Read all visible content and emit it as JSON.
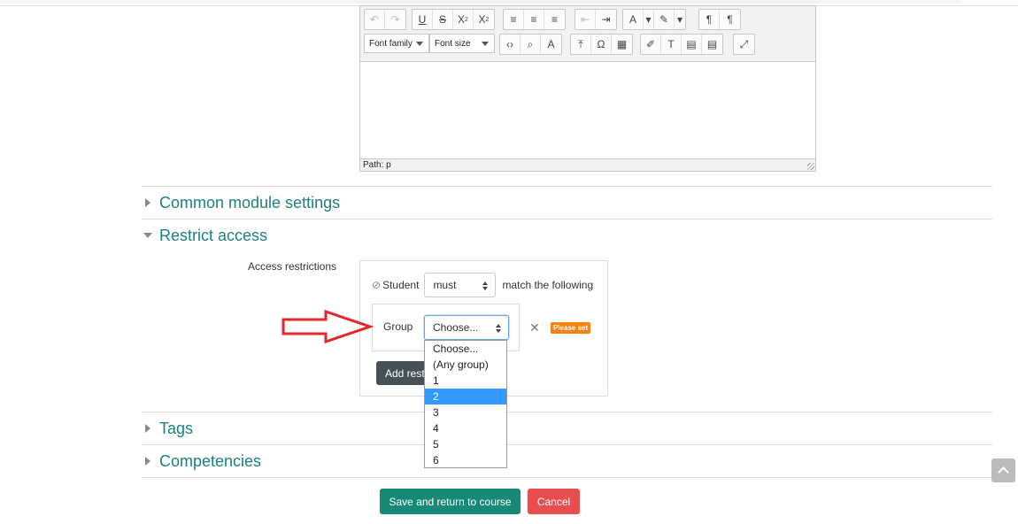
{
  "editor": {
    "font_family_label": "Font family",
    "font_size_label": "Font size",
    "path_label": "Path: p"
  },
  "sections": {
    "common_module": "Common module settings",
    "restrict_access": "Restrict access",
    "tags": "Tags",
    "competencies": "Competencies"
  },
  "restrict": {
    "access_label": "Access restrictions",
    "student_label": "Student",
    "must_value": "must",
    "match_text": "match the following",
    "group_label": "Group",
    "group_select_value": "Choose...",
    "please_set_badge": "Please set",
    "add_restriction_label": "Add restriction..."
  },
  "dropdown": {
    "options": [
      "Choose...",
      "(Any group)",
      "1",
      "2",
      "3",
      "4",
      "5",
      "6"
    ],
    "selected_index": 3
  },
  "buttons": {
    "save_return": "Save and return to course",
    "cancel": "Cancel"
  },
  "colors": {
    "accent": "#1c8080",
    "save": "#168a75",
    "cancel": "#e94e4e",
    "badge": "#f98012",
    "arrow": "#e3262b"
  }
}
